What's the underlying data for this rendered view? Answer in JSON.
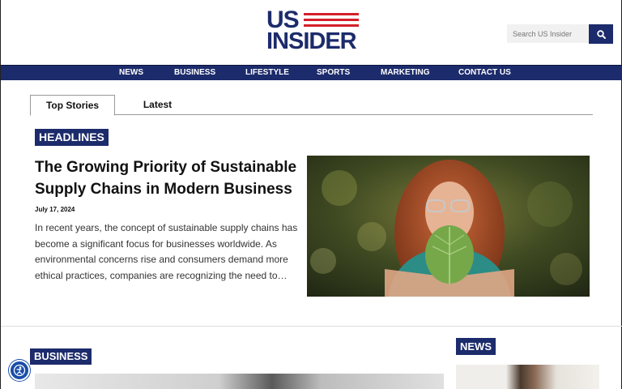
{
  "logo": {
    "line1": "US",
    "line2": "INSIDER"
  },
  "search": {
    "placeholder": "Search US Insider",
    "icon": "search-icon"
  },
  "nav": {
    "items": [
      "NEWS",
      "BUSINESS",
      "LIFESTYLE",
      "SPORTS",
      "MARKETING",
      "CONTACT US"
    ]
  },
  "tabs": {
    "top_stories": "Top Stories",
    "latest": "Latest"
  },
  "featured": {
    "badge": "HEADLINES",
    "title": "The Growing Priority of Sustainable Supply Chains in Modern Business",
    "date": "July 17, 2024",
    "excerpt": "In recent years, the concept of sustainable supply chains has become a significant focus for businesses worldwide. As environmental concerns rise and consumers demand more ethical practices, companies are recognizing the need to…"
  },
  "sections": {
    "business": "BUSINESS",
    "news": "NEWS"
  },
  "colors": {
    "brand_navy": "#1c2b6b",
    "brand_red": "#d4202b",
    "accessibility_blue": "#1a4da8"
  }
}
